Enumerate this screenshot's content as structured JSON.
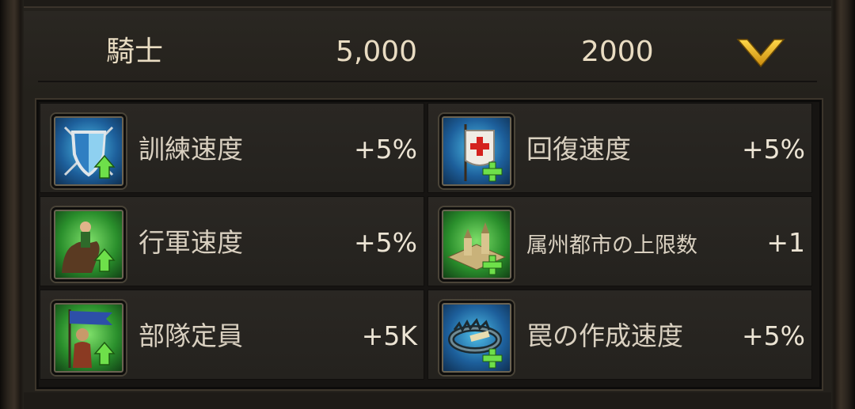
{
  "header": {
    "unit_name": "騎士",
    "count": "5,000",
    "power": "2000",
    "expand_icon": "chevron-down-icon",
    "accent_color": "#e8b11a"
  },
  "bonuses": [
    {
      "label": "訓練速度",
      "value": "+5%",
      "icon": "shield-training-icon"
    },
    {
      "label": "回復速度",
      "value": "+5%",
      "icon": "healing-banner-icon"
    },
    {
      "label": "行軍速度",
      "value": "+5%",
      "icon": "cavalry-march-icon"
    },
    {
      "label": "属州都市の上限数",
      "value": "+1",
      "icon": "city-icon"
    },
    {
      "label": "部隊定員",
      "value": "+5K",
      "icon": "soldier-banner-icon"
    },
    {
      "label": "罠の作成速度",
      "value": "+5%",
      "icon": "trap-icon"
    }
  ]
}
